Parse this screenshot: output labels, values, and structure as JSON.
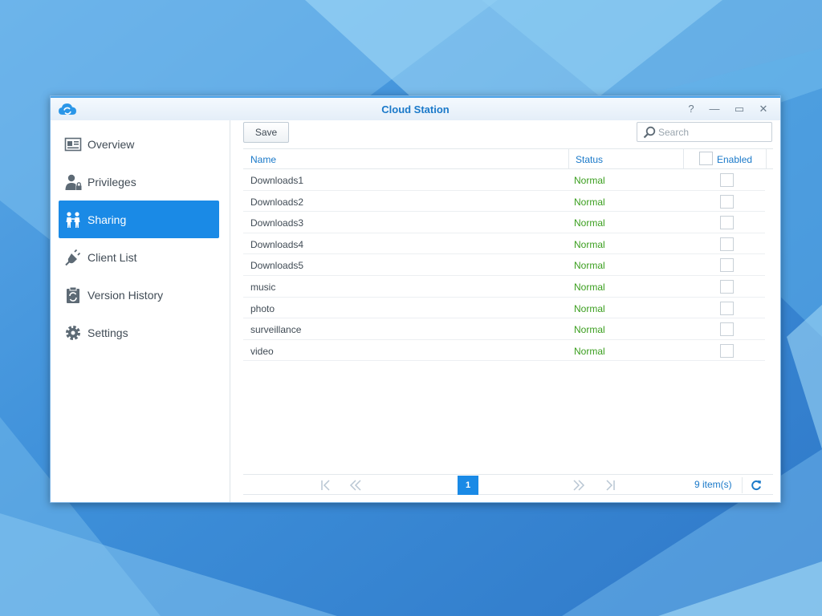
{
  "window": {
    "title": "Cloud Station",
    "controls": {
      "help": "?",
      "minimize": "—",
      "maximize": "▭",
      "close": "✕"
    }
  },
  "sidebar": {
    "items": [
      {
        "label": "Overview",
        "icon": "overview-icon",
        "active": false
      },
      {
        "label": "Privileges",
        "icon": "privileges-icon",
        "active": false
      },
      {
        "label": "Sharing",
        "icon": "sharing-icon",
        "active": true
      },
      {
        "label": "Client List",
        "icon": "client-list-icon",
        "active": false
      },
      {
        "label": "Version History",
        "icon": "version-history-icon",
        "active": false
      },
      {
        "label": "Settings",
        "icon": "gear-icon",
        "active": false
      }
    ]
  },
  "toolbar": {
    "save_label": "Save",
    "search_placeholder": "Search"
  },
  "table": {
    "columns": {
      "name": "Name",
      "status": "Status",
      "enabled": "Enabled"
    },
    "rows": [
      {
        "name": "Downloads1",
        "status": "Normal",
        "enabled": false
      },
      {
        "name": "Downloads2",
        "status": "Normal",
        "enabled": false
      },
      {
        "name": "Downloads3",
        "status": "Normal",
        "enabled": false
      },
      {
        "name": "Downloads4",
        "status": "Normal",
        "enabled": false
      },
      {
        "name": "Downloads5",
        "status": "Normal",
        "enabled": false
      },
      {
        "name": "music",
        "status": "Normal",
        "enabled": false
      },
      {
        "name": "photo",
        "status": "Normal",
        "enabled": false
      },
      {
        "name": "surveillance",
        "status": "Normal",
        "enabled": false
      },
      {
        "name": "video",
        "status": "Normal",
        "enabled": false
      }
    ]
  },
  "pager": {
    "current_page": "1",
    "item_count": "9 item(s)"
  },
  "colors": {
    "accent": "#1a8ae6",
    "title": "#1a79c9",
    "status_normal": "#3a9e1e"
  }
}
